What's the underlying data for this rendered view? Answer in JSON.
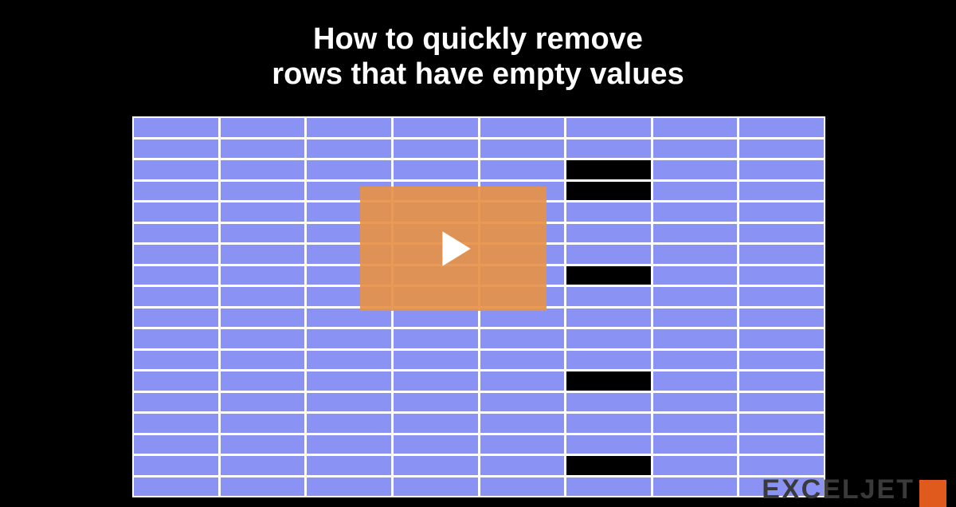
{
  "title_line1": "How to quickly remove",
  "title_line2": "rows that have empty values",
  "grid": {
    "rows": 18,
    "cols": 8,
    "empty_cells": [
      {
        "row": 2,
        "col": 5
      },
      {
        "row": 3,
        "col": 5
      },
      {
        "row": 7,
        "col": 5
      },
      {
        "row": 12,
        "col": 5
      },
      {
        "row": 16,
        "col": 5
      }
    ]
  },
  "brand": "EXCELJET",
  "icons": {
    "play": "play-icon"
  },
  "colors": {
    "cell": "#8a93f3",
    "overlay": "#e69148",
    "brand_mark": "#e05a1e"
  }
}
